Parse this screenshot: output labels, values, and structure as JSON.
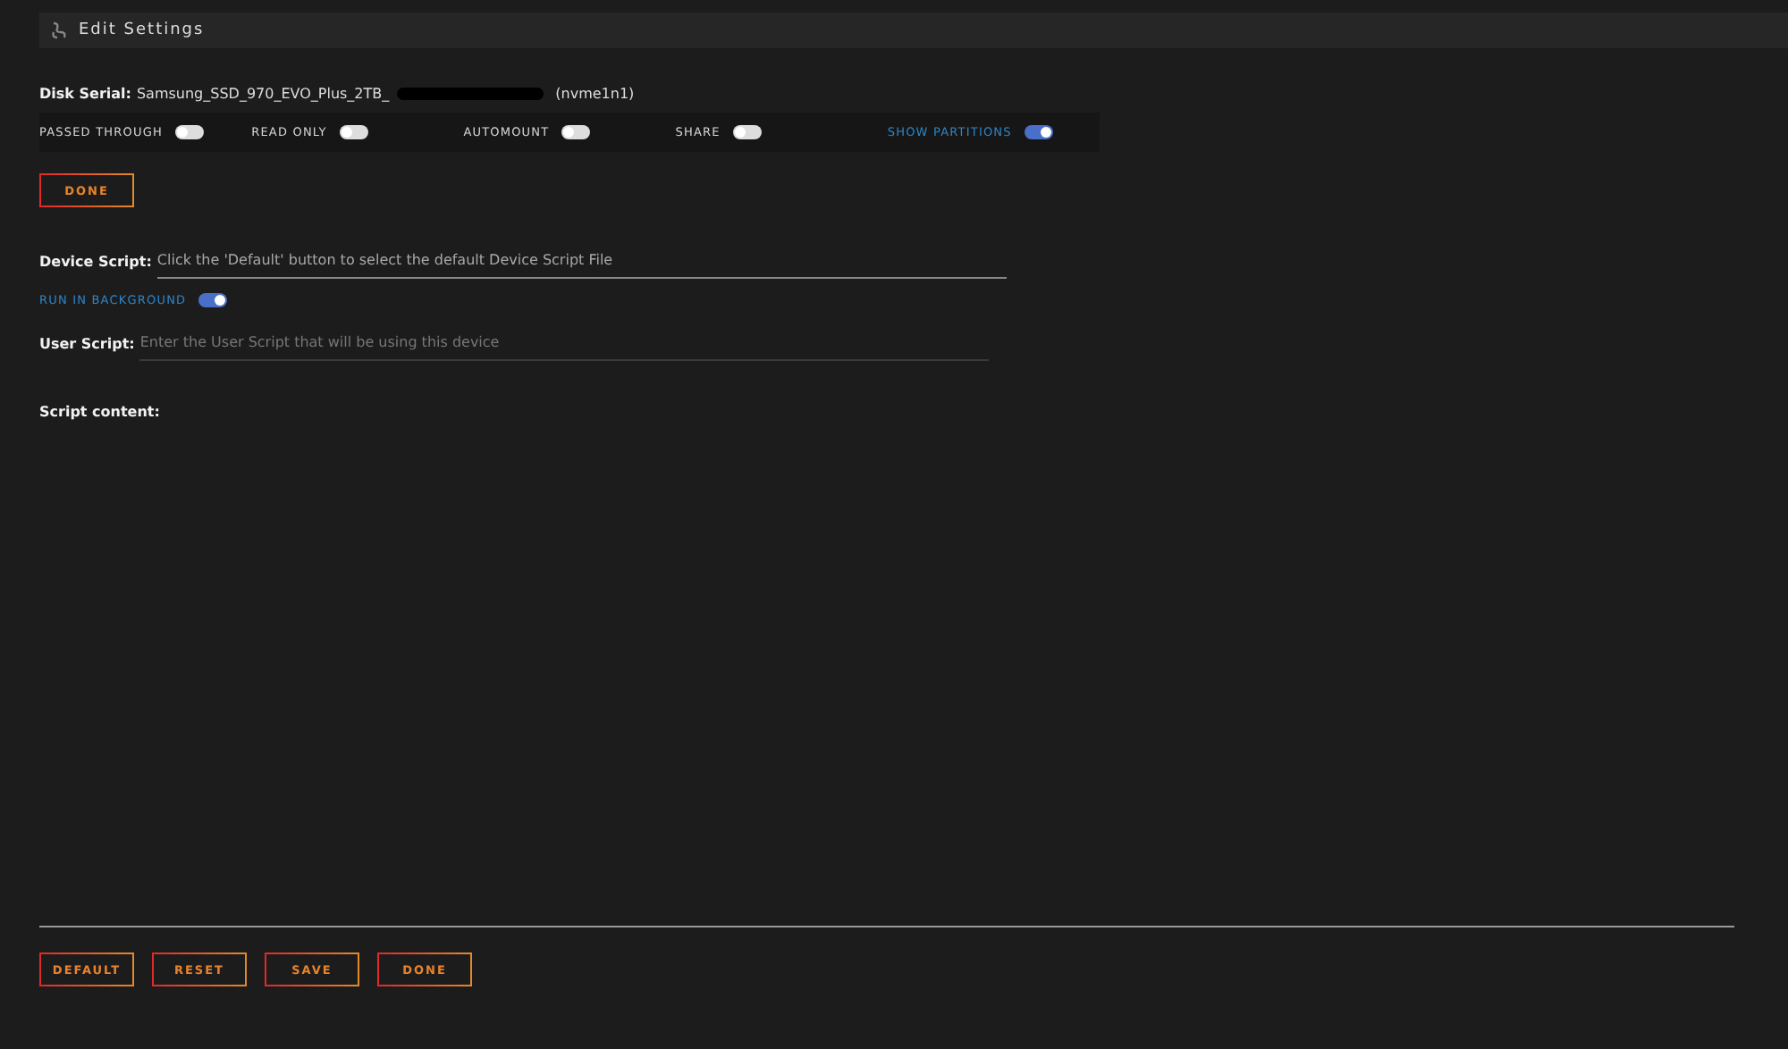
{
  "header": {
    "title": "Edit Settings"
  },
  "disk_serial": {
    "label": "Disk Serial:",
    "value": "Samsung_SSD_970_EVO_Plus_2TB_",
    "device": "(nvme1n1)",
    "redacted": true
  },
  "toggles": [
    {
      "label": "PASSED THROUGH",
      "on": false
    },
    {
      "label": "READ ONLY",
      "on": false
    },
    {
      "label": "AUTOMOUNT",
      "on": false
    },
    {
      "label": "SHARE",
      "on": false
    },
    {
      "label": "SHOW PARTITIONS",
      "on": true
    }
  ],
  "done_button": "DONE",
  "device_script": {
    "label": "Device Script:",
    "placeholder": "Click the 'Default' button to select the default Device Script File"
  },
  "run_in_background": {
    "label": "RUN IN BACKGROUND",
    "on": true
  },
  "user_script": {
    "label": "User Script:",
    "placeholder": "Enter the User Script that will be using this device"
  },
  "script_content": {
    "label": "Script content:"
  },
  "footer_buttons": [
    "DEFAULT",
    "RESET",
    "SAVE",
    "DONE"
  ]
}
